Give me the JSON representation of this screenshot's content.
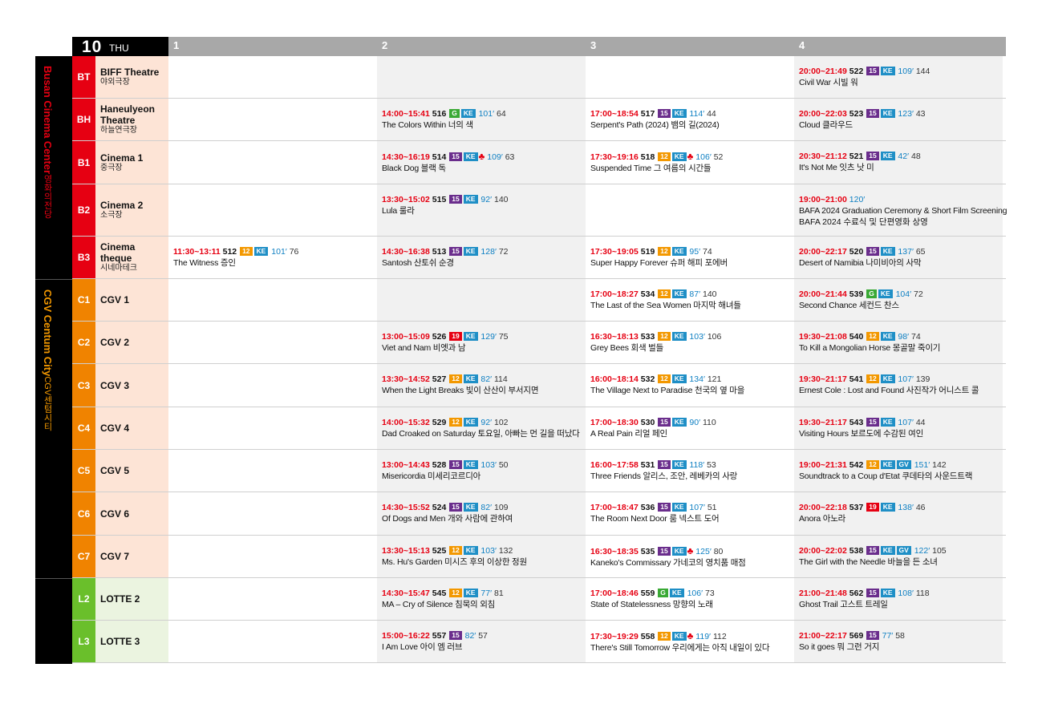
{
  "header": {
    "day_num": "10",
    "weekday": "THU",
    "slots": [
      "1",
      "2",
      "3",
      "4"
    ]
  },
  "venues": [
    {
      "name_en": "Busan Cinema Center",
      "name_kr": "영화의전당",
      "text_color": "#e60012"
    },
    {
      "name_en": "CGV Centum City",
      "name_kr": "CGV센텀시티",
      "text_color": "#f39800"
    },
    {
      "name_en": "",
      "name_kr": "",
      "text_color": "#ffffff"
    }
  ],
  "rows": [
    {
      "code": "BT",
      "name_en": "BIFF Theatre",
      "name_kr": "야외극장",
      "color": "#e60012",
      "bg": "#fde4d6",
      "slots": [
        null,
        null,
        null,
        {
          "time": "20:00~21:49",
          "code": "522",
          "badges": [
            "15",
            "KE"
          ],
          "club": false,
          "runtime": "109′",
          "extra": "144",
          "title": "Civil War 시빌 워"
        }
      ]
    },
    {
      "code": "BH",
      "name_en": "Haneulyeon Theatre",
      "name_kr": "하늘연극장",
      "color": "#e60012",
      "bg": "#fde4d6",
      "slots": [
        null,
        {
          "time": "14:00~15:41",
          "code": "516",
          "badges": [
            "G",
            "KE"
          ],
          "club": false,
          "runtime": "101′",
          "extra": "64",
          "title": "The Colors Within 너의 색"
        },
        {
          "time": "17:00~18:54",
          "code": "517",
          "badges": [
            "15",
            "KE"
          ],
          "club": false,
          "runtime": "114′",
          "extra": "44",
          "title": "Serpent's Path (2024) 뱀의 길(2024)"
        },
        {
          "time": "20:00~22:03",
          "code": "523",
          "badges": [
            "15",
            "KE"
          ],
          "club": false,
          "runtime": "123′",
          "extra": "43",
          "title": "Cloud 클라우드"
        }
      ]
    },
    {
      "code": "B1",
      "name_en": "Cinema 1",
      "name_kr": "중극장",
      "color": "#e60012",
      "bg": "#fde4d6",
      "slots": [
        null,
        {
          "time": "14:30~16:19",
          "code": "514",
          "badges": [
            "15",
            "KE"
          ],
          "club": true,
          "runtime": "109′",
          "extra": "63",
          "title": "Black Dog 블랙 독"
        },
        {
          "time": "17:30~19:16",
          "code": "518",
          "badges": [
            "12",
            "KE"
          ],
          "club": true,
          "runtime": "106′",
          "extra": "52",
          "title": "Suspended Time 그 여름의 시간들"
        },
        {
          "time": "20:30~21:12",
          "code": "521",
          "badges": [
            "15",
            "KE"
          ],
          "club": false,
          "runtime": "42′",
          "extra": "48",
          "title": "It's Not Me 잇츠 낫 미"
        }
      ]
    },
    {
      "code": "B2",
      "name_en": "Cinema 2",
      "name_kr": "소극장",
      "color": "#e60012",
      "bg": "#fde4d6",
      "slots": [
        null,
        {
          "time": "13:30~15:02",
          "code": "515",
          "badges": [
            "15",
            "KE"
          ],
          "club": false,
          "runtime": "92′",
          "extra": "140",
          "title": "Lula 룰라"
        },
        null,
        {
          "time": "19:00~21:00",
          "code": "",
          "badges": [],
          "club": false,
          "runtime": "120′",
          "extra": "",
          "title": "BAFA 2024 Graduation Ceremony & Short Film Screening",
          "title2": "BAFA 2024 수료식 및 단편영화 상영"
        }
      ]
    },
    {
      "code": "B3",
      "name_en": "Cinema theque",
      "name_kr": "시네마테크",
      "color": "#e60012",
      "bg": "#fde4d6",
      "slots": [
        {
          "time": "11:30~13:11",
          "code": "512",
          "badges": [
            "12",
            "KE"
          ],
          "club": false,
          "runtime": "101′",
          "extra": "76",
          "title": "The Witness 증인"
        },
        {
          "time": "14:30~16:38",
          "code": "513",
          "badges": [
            "15",
            "KE"
          ],
          "club": false,
          "runtime": "128′",
          "extra": "72",
          "title": "Santosh 산토쉬 순경"
        },
        {
          "time": "17:30~19:05",
          "code": "519",
          "badges": [
            "12",
            "KE"
          ],
          "club": false,
          "runtime": "95′",
          "extra": "74",
          "title": "Super Happy Forever 슈퍼 해피 포에버"
        },
        {
          "time": "20:00~22:17",
          "code": "520",
          "badges": [
            "15",
            "KE"
          ],
          "club": false,
          "runtime": "137′",
          "extra": "65",
          "title": "Desert of Namibia 나미비아의 사막"
        }
      ]
    },
    {
      "code": "C1",
      "name_en": "CGV 1",
      "name_kr": "",
      "color": "#f08300",
      "bg": "#fde4d6",
      "slots": [
        null,
        null,
        {
          "time": "17:00~18:27",
          "code": "534",
          "badges": [
            "12",
            "KE"
          ],
          "club": false,
          "runtime": "87′",
          "extra": "140",
          "title": "The Last of the Sea Women 마지막 해녀들"
        },
        {
          "time": "20:00~21:44",
          "code": "539",
          "badges": [
            "G",
            "KE"
          ],
          "club": false,
          "runtime": "104′",
          "extra": "72",
          "title": "Second Chance 세컨드 찬스"
        }
      ]
    },
    {
      "code": "C2",
      "name_en": "CGV 2",
      "name_kr": "",
      "color": "#f08300",
      "bg": "#fde4d6",
      "slots": [
        null,
        {
          "time": "13:00~15:09",
          "code": "526",
          "badges": [
            "19",
            "KE"
          ],
          "club": false,
          "runtime": "129′",
          "extra": "75",
          "title": "Viet and Nam 비엣과 남"
        },
        {
          "time": "16:30~18:13",
          "code": "533",
          "badges": [
            "12",
            "KE"
          ],
          "club": false,
          "runtime": "103′",
          "extra": "106",
          "title": "Grey Bees 회색 벌들"
        },
        {
          "time": "19:30~21:08",
          "code": "540",
          "badges": [
            "12",
            "KE"
          ],
          "club": false,
          "runtime": "98′",
          "extra": "74",
          "title": "To Kill a Mongolian Horse 몽골말 죽이기"
        }
      ]
    },
    {
      "code": "C3",
      "name_en": "CGV 3",
      "name_kr": "",
      "color": "#f08300",
      "bg": "#fde4d6",
      "slots": [
        null,
        {
          "time": "13:30~14:52",
          "code": "527",
          "badges": [
            "12",
            "KE"
          ],
          "club": false,
          "runtime": "82′",
          "extra": "114",
          "title": "When the Light Breaks 빛이 산산이 부서지면"
        },
        {
          "time": "16:00~18:14",
          "code": "532",
          "badges": [
            "12",
            "KE"
          ],
          "club": false,
          "runtime": "134′",
          "extra": "121",
          "title": "The Village Next to Paradise 천국의 옆 마을"
        },
        {
          "time": "19:30~21:17",
          "code": "541",
          "badges": [
            "12",
            "KE"
          ],
          "club": false,
          "runtime": "107′",
          "extra": "139",
          "title": "Ernest Cole : Lost and Found 사진작가 어니스트 콜"
        }
      ]
    },
    {
      "code": "C4",
      "name_en": "CGV 4",
      "name_kr": "",
      "color": "#f08300",
      "bg": "#fde4d6",
      "slots": [
        null,
        {
          "time": "14:00~15:32",
          "code": "529",
          "badges": [
            "12",
            "KE"
          ],
          "club": false,
          "runtime": "92′",
          "extra": "102",
          "title": "Dad Croaked on Saturday 토요일, 아빠는 먼 길을 떠났다"
        },
        {
          "time": "17:00~18:30",
          "code": "530",
          "badges": [
            "15",
            "KE"
          ],
          "club": false,
          "runtime": "90′",
          "extra": "110",
          "title": "A Real Pain 리얼 페인"
        },
        {
          "time": "19:30~21:17",
          "code": "543",
          "badges": [
            "15",
            "KE"
          ],
          "club": false,
          "runtime": "107′",
          "extra": "44",
          "title": "Visiting Hours 보르도에 수감된 여인"
        }
      ]
    },
    {
      "code": "C5",
      "name_en": "CGV 5",
      "name_kr": "",
      "color": "#f08300",
      "bg": "#fde4d6",
      "slots": [
        null,
        {
          "time": "13:00~14:43",
          "code": "528",
          "badges": [
            "15",
            "KE"
          ],
          "club": false,
          "runtime": "103′",
          "extra": "50",
          "title": "Misericordia 미세리코르디아"
        },
        {
          "time": "16:00~17:58",
          "code": "531",
          "badges": [
            "15",
            "KE"
          ],
          "club": false,
          "runtime": "118′",
          "extra": "53",
          "title": "Three Friends 알리스, 조안, 레베카의 사랑"
        },
        {
          "time": "19:00~21:31",
          "code": "542",
          "badges": [
            "12",
            "KE",
            "GV"
          ],
          "club": false,
          "runtime": "151′",
          "extra": "142",
          "title": "Soundtrack to a Coup d'Etat 쿠데타의 사운드트랙"
        }
      ]
    },
    {
      "code": "C6",
      "name_en": "CGV 6",
      "name_kr": "",
      "color": "#f08300",
      "bg": "#fde4d6",
      "slots": [
        null,
        {
          "time": "14:30~15:52",
          "code": "524",
          "badges": [
            "15",
            "KE"
          ],
          "club": false,
          "runtime": "82′",
          "extra": "109",
          "title": "Of Dogs and Men 개와 사람에 관하여"
        },
        {
          "time": "17:00~18:47",
          "code": "536",
          "badges": [
            "15",
            "KE"
          ],
          "club": false,
          "runtime": "107′",
          "extra": "51",
          "title": "The Room Next Door 룸 넥스트 도어"
        },
        {
          "time": "20:00~22:18",
          "code": "537",
          "badges": [
            "19",
            "KE"
          ],
          "club": false,
          "runtime": "138′",
          "extra": "46",
          "title": "Anora 아노라"
        }
      ]
    },
    {
      "code": "C7",
      "name_en": "CGV 7",
      "name_kr": "",
      "color": "#f08300",
      "bg": "#fde4d6",
      "slots": [
        null,
        {
          "time": "13:30~15:13",
          "code": "525",
          "badges": [
            "12",
            "KE"
          ],
          "club": false,
          "runtime": "103′",
          "extra": "132",
          "title": "Ms. Hu's Garden 미시즈 후의 이상한 정원"
        },
        {
          "time": "16:30~18:35",
          "code": "535",
          "badges": [
            "15",
            "KE"
          ],
          "club": true,
          "runtime": "125′",
          "extra": "80",
          "title": "Kaneko's Commissary 가네코의 영치품 매점"
        },
        {
          "time": "20:00~22:02",
          "code": "538",
          "badges": [
            "15",
            "KE",
            "GV"
          ],
          "club": false,
          "runtime": "122′",
          "extra": "105",
          "title": "The Girl with the Needle 바늘을 든 소녀"
        }
      ]
    },
    {
      "code": "L2",
      "name_en": "LOTTE 2",
      "name_kr": "",
      "color": "#6abf2b",
      "bg": "#ebf4e0",
      "slots": [
        null,
        {
          "time": "14:30~15:47",
          "code": "545",
          "badges": [
            "12",
            "KE"
          ],
          "club": false,
          "runtime": "77′",
          "extra": "81",
          "title": "MA – Cry of Silence 침묵의 외침"
        },
        {
          "time": "17:00~18:46",
          "code": "559",
          "badges": [
            "G",
            "KE"
          ],
          "club": false,
          "runtime": "106′",
          "extra": "73",
          "title": "State of Statelessness 망향의 노래"
        },
        {
          "time": "21:00~21:48",
          "code": "562",
          "badges": [
            "15",
            "KE"
          ],
          "club": false,
          "runtime": "108′",
          "extra": "118",
          "title": "Ghost Trail 고스트 트레일"
        }
      ]
    },
    {
      "code": "L3",
      "name_en": "LOTTE 3",
      "name_kr": "",
      "color": "#6abf2b",
      "bg": "#ebf4e0",
      "slots": [
        null,
        {
          "time": "15:00~16:22",
          "code": "557",
          "badges": [
            "15"
          ],
          "club": false,
          "runtime": "82′",
          "extra": "57",
          "title": "I Am Love 아이 엠 러브"
        },
        {
          "time": "17:30~19:29",
          "code": "558",
          "badges": [
            "12",
            "KE"
          ],
          "club": true,
          "runtime": "119′",
          "extra": "112",
          "title": "There's Still Tomorrow 우리에게는 아직 내일이 있다"
        },
        {
          "time": "21:00~22:17",
          "code": "569",
          "badges": [
            "15"
          ],
          "club": false,
          "runtime": "77′",
          "extra": "58",
          "title": "So it goes 뭐 그런 거지"
        }
      ]
    }
  ]
}
